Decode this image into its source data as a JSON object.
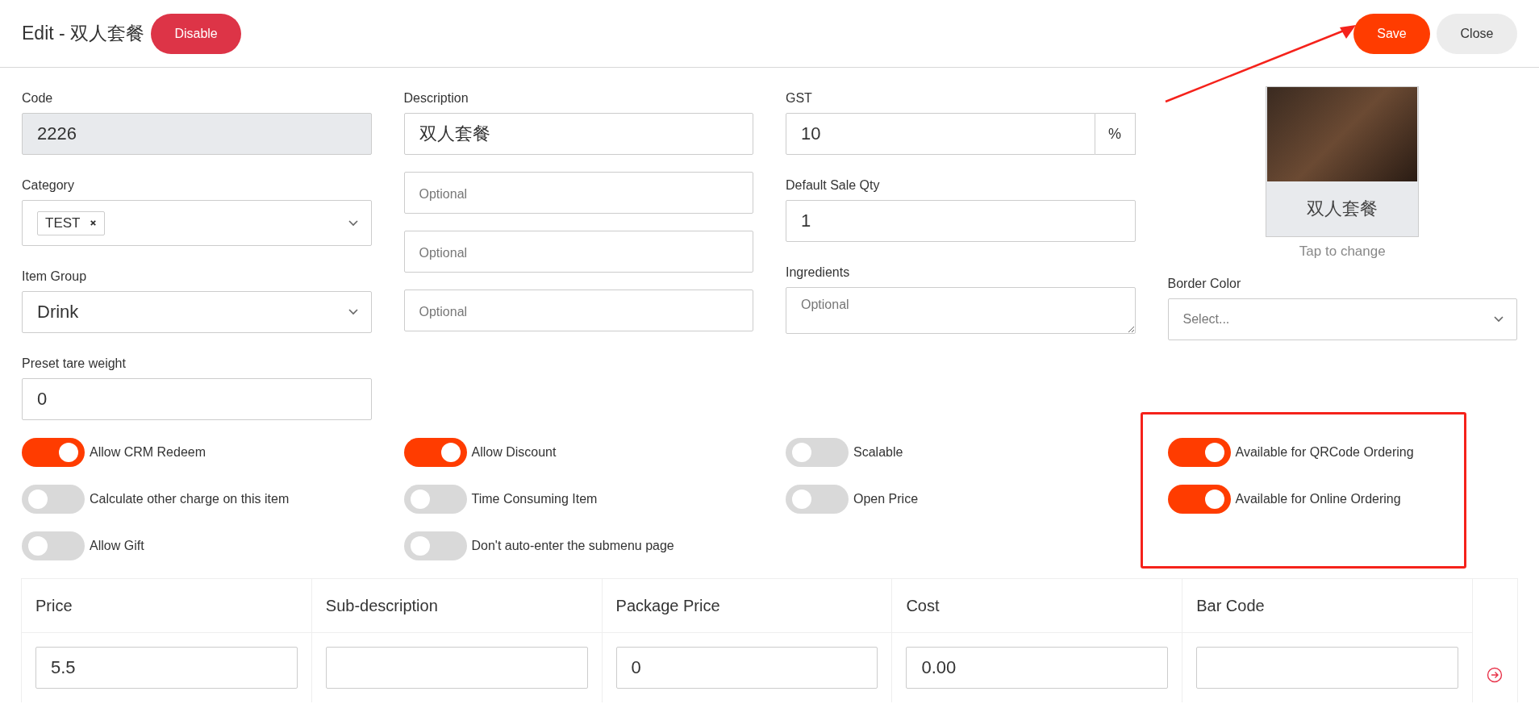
{
  "header": {
    "title": "Edit - 双人套餐",
    "disable_button": "Disable",
    "save_button": "Save",
    "close_button": "Close"
  },
  "code": {
    "label": "Code",
    "value": "2226"
  },
  "category": {
    "label": "Category",
    "tags": [
      "TEST"
    ]
  },
  "item_group": {
    "label": "Item Group",
    "value": "Drink"
  },
  "preset_tare_weight": {
    "label": "Preset tare weight",
    "value": "0"
  },
  "description": {
    "label": "Description",
    "value": "双人套餐"
  },
  "description_extra": [
    {
      "placeholder": "Optional"
    },
    {
      "placeholder": "Optional"
    },
    {
      "placeholder": "Optional"
    }
  ],
  "gst": {
    "label": "GST",
    "value": "10",
    "unit": "%"
  },
  "default_sale_qty": {
    "label": "Default Sale Qty",
    "value": "1"
  },
  "ingredients": {
    "label": "Ingredients",
    "placeholder": "Optional"
  },
  "image": {
    "caption": "双人套餐",
    "hint": "Tap to change"
  },
  "border_color": {
    "label": "Border Color",
    "placeholder": "Select..."
  },
  "toggle_columns": [
    {
      "items": [
        {
          "label": "Allow CRM Redeem",
          "on": true
        },
        {
          "label": "Calculate other charge on this item",
          "on": false
        },
        {
          "label": "Allow Gift",
          "on": false
        }
      ]
    },
    {
      "items": [
        {
          "label": "Allow Discount",
          "on": true
        },
        {
          "label": "Time Consuming Item",
          "on": false
        },
        {
          "label": "Don't auto-enter the submenu page",
          "on": false
        }
      ]
    },
    {
      "items": [
        {
          "label": "Scalable",
          "on": false
        },
        {
          "label": "Open Price",
          "on": false
        }
      ]
    },
    {
      "items": [
        {
          "label": "Available for QRCode Ordering",
          "on": true
        },
        {
          "label": "Available for Online Ordering",
          "on": true
        }
      ]
    }
  ],
  "price_table": {
    "columns": [
      "Price",
      "Sub-description",
      "Package Price",
      "Cost",
      "Bar Code"
    ],
    "rows": [
      {
        "cells": [
          {
            "value": "5.5"
          },
          {},
          {
            "value": "0"
          },
          {
            "value": "0.00"
          },
          {}
        ]
      }
    ]
  }
}
